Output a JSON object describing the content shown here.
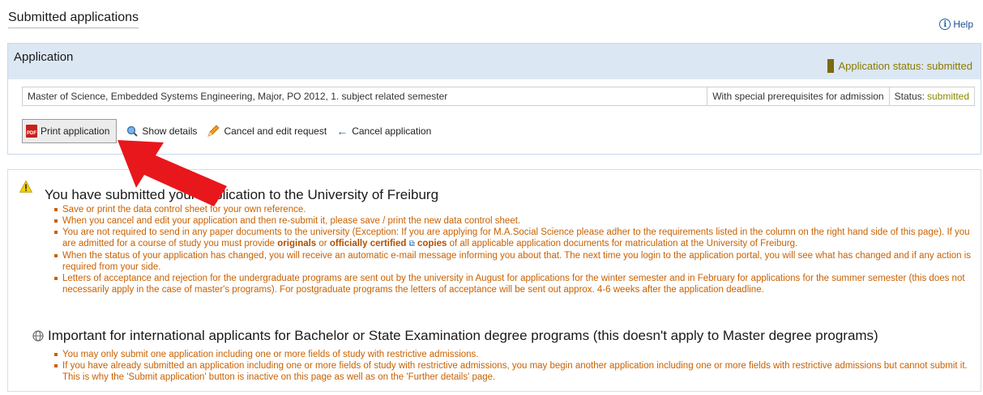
{
  "header": {
    "title": "Submitted applications",
    "help_label": "Help"
  },
  "application": {
    "panel_title": "Application",
    "status_label": "Application status: submitted",
    "row": {
      "program": "Master of Science, Embedded Systems Engineering, Major, PO 2012, 1. subject related semester",
      "prerequisites": "With special prerequisites for admission",
      "status_prefix": "Status:",
      "status_value": "submitted"
    },
    "actions": {
      "print": "Print application",
      "details": "Show details",
      "cancel_edit": "Cancel and edit request",
      "cancel": "Cancel application"
    }
  },
  "info": {
    "heading": "You have submitted your application to the University of Freiburg",
    "bullets": {
      "b1": "Save or print the data control sheet for your own reference.",
      "b2": "When you cancel and edit your application and then re-submit it, please save / print the new data control sheet.",
      "b3a": "You are not required to send in any paper documents to the university (Exception: If you are applying for M.A.Social Science please adher to the requirements listed in the column on the right hand side of this page). If you are admitted for a course of study you must provide ",
      "b3_originals": "originals",
      "b3_or": " or ",
      "b3_cert": "officially certified",
      "b3_copies": " copies",
      "b3b": " of all applicable application documents for matriculation at the University of Freiburg.",
      "b4": "When the status of your application has changed, you will receive an automatic e-mail message informing you about that. The next time you login to the application portal, you will see what has changed and if any action is required from your side.",
      "b5": "Letters of acceptance and rejection for the undergraduate programs are sent out by the university in August for applications for the winter semester and in February for applications for the summer semester (this does not necessarily apply in the case of master's programs). For postgraduate programs the letters of acceptance will be sent out approx. 4-6 weeks after the application deadline."
    },
    "heading2": "Important for international applicants for Bachelor or State Examination degree programs (this doesn't apply to Master degree programs)",
    "bullets2": {
      "c1": "You may only submit one application including one or more fields of study with restrictive admissions.",
      "c2": "If you have already submitted an application including one or more fields of study with restrictive admissions, you may begin another application including one or more fields with restrictive admissions but cannot submit it. This is why the 'Submit application' button is inactive on this page as well as on the 'Further details' page."
    }
  },
  "colors": {
    "status": "#8a7a00",
    "bullet_text": "#c96100",
    "header_bg": "#dbe7f3",
    "annotation_arrow": "#e8171b"
  },
  "icons": [
    "help-icon",
    "pdf-icon",
    "magnifier-icon",
    "pencil-icon",
    "arrow-left-icon",
    "warning-icon",
    "external-link-icon",
    "globe-icon"
  ]
}
